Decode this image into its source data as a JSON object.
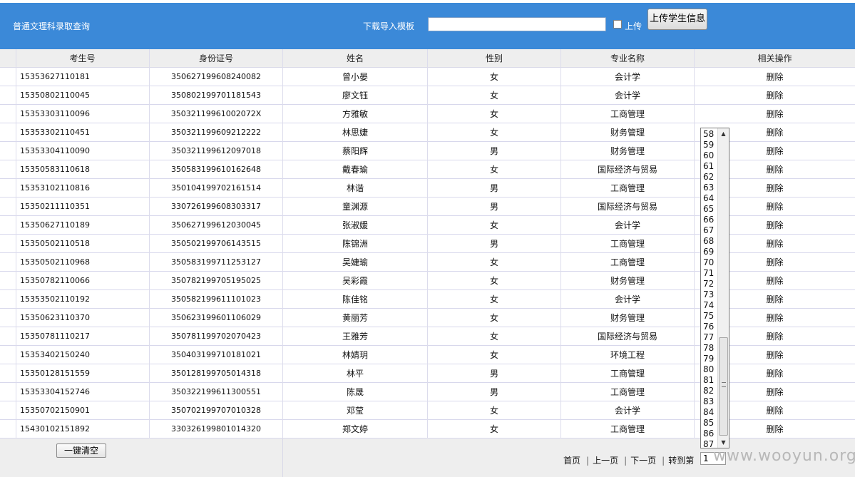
{
  "header": {
    "title": "普通文理科录取查询",
    "download_template": "下载导入模板",
    "file_value": "",
    "upload_checkbox_label": "上传",
    "upload_button": "上传学生信息"
  },
  "table": {
    "columns": [
      "考生号",
      "身份证号",
      "姓名",
      "性别",
      "专业名称",
      "相关操作"
    ],
    "rows": [
      {
        "id": "15353627110181",
        "idcard": "350627199608240082",
        "name": "曾小晏",
        "gender": "女",
        "major": "会计学",
        "action": "删除"
      },
      {
        "id": "15350802110045",
        "idcard": "350802199701181543",
        "name": "廖文钰",
        "gender": "女",
        "major": "会计学",
        "action": "删除"
      },
      {
        "id": "15353303110096",
        "idcard": "35032119961002072X",
        "name": "方雅敏",
        "gender": "女",
        "major": "工商管理",
        "action": "删除"
      },
      {
        "id": "15353302110451",
        "idcard": "350321199609212222",
        "name": "林思婕",
        "gender": "女",
        "major": "财务管理",
        "action": "删除"
      },
      {
        "id": "15353304110090",
        "idcard": "350321199612097018",
        "name": "蔡阳辉",
        "gender": "男",
        "major": "财务管理",
        "action": "删除"
      },
      {
        "id": "15350583110618",
        "idcard": "350583199610162648",
        "name": "戴春瑜",
        "gender": "女",
        "major": "国际经济与贸易",
        "action": "删除"
      },
      {
        "id": "15353102110816",
        "idcard": "350104199702161514",
        "name": "林谐",
        "gender": "男",
        "major": "工商管理",
        "action": "删除"
      },
      {
        "id": "15350211110351",
        "idcard": "330726199608303317",
        "name": "童渊源",
        "gender": "男",
        "major": "国际经济与贸易",
        "action": "删除"
      },
      {
        "id": "15350627110189",
        "idcard": "350627199612030045",
        "name": "张淑媛",
        "gender": "女",
        "major": "会计学",
        "action": "删除"
      },
      {
        "id": "15350502110518",
        "idcard": "350502199706143515",
        "name": "陈锦洲",
        "gender": "男",
        "major": "工商管理",
        "action": "删除"
      },
      {
        "id": "15350502110968",
        "idcard": "350583199711253127",
        "name": "吴婕瑜",
        "gender": "女",
        "major": "工商管理",
        "action": "删除"
      },
      {
        "id": "15350782110066",
        "idcard": "350782199705195025",
        "name": "吴彩霞",
        "gender": "女",
        "major": "财务管理",
        "action": "删除"
      },
      {
        "id": "15353502110192",
        "idcard": "350582199611101023",
        "name": "陈佳铭",
        "gender": "女",
        "major": "会计学",
        "action": "删除"
      },
      {
        "id": "15350623110370",
        "idcard": "350623199601106029",
        "name": "黄丽芳",
        "gender": "女",
        "major": "财务管理",
        "action": "删除"
      },
      {
        "id": "15350781110217",
        "idcard": "350781199702070423",
        "name": "王雅芳",
        "gender": "女",
        "major": "国际经济与贸易",
        "action": "删除"
      },
      {
        "id": "15353402150240",
        "idcard": "350403199710181021",
        "name": "林婧玥",
        "gender": "女",
        "major": "环境工程",
        "action": "删除"
      },
      {
        "id": "15350128151559",
        "idcard": "350128199705014318",
        "name": "林平",
        "gender": "男",
        "major": "工商管理",
        "action": "删除"
      },
      {
        "id": "15353304152746",
        "idcard": "350322199611300551",
        "name": "陈晟",
        "gender": "男",
        "major": "工商管理",
        "action": "删除"
      },
      {
        "id": "15350702150901",
        "idcard": "350702199707010328",
        "name": "邓莹",
        "gender": "女",
        "major": "会计学",
        "action": "删除"
      },
      {
        "id": "15430102151892",
        "idcard": "330326199801014320",
        "name": "郑文婷",
        "gender": "女",
        "major": "工商管理",
        "action": "删除"
      }
    ]
  },
  "footer": {
    "clear_button": "一键清空",
    "first": "首页",
    "prev": "上一页",
    "next": "下一页",
    "goto": "转到第",
    "selected_page": "1"
  },
  "page_dropdown": {
    "options": [
      "58",
      "59",
      "60",
      "61",
      "62",
      "63",
      "64",
      "65",
      "66",
      "67",
      "68",
      "69",
      "70",
      "71",
      "72",
      "73",
      "74",
      "75",
      "76",
      "77",
      "78",
      "79",
      "80",
      "81",
      "82",
      "83",
      "84",
      "85",
      "86",
      "87"
    ]
  },
  "watermark": "www.wooyun.org"
}
